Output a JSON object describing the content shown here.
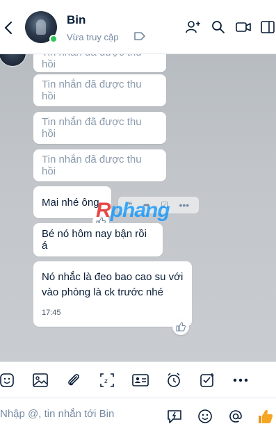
{
  "header": {
    "contact_name": "Bin",
    "status": "Vừa truy cập"
  },
  "messages": [
    {
      "text": "Tin nhắn đã được thu hồi",
      "recalled": true
    },
    {
      "text": "Tin nhắn đã được thu hồi",
      "recalled": true
    },
    {
      "text": "Tin nhắn đã được thu hồi",
      "recalled": true
    },
    {
      "text": "Tin nhắn đã được thu hồi",
      "recalled": true
    },
    {
      "text": "Mai nhé ông",
      "recalled": false
    },
    {
      "text": "Bé nó hôm nay bận rồi á",
      "recalled": false
    },
    {
      "text_line1": "Nó nhắc là đeo bao cao su với",
      "text_line2": "vào phòng là ck trước nhé",
      "time": "17:45",
      "recalled": false
    }
  ],
  "watermark": {
    "first": "R",
    "rest": "phang"
  },
  "composer": {
    "placeholder": "Nhập @, tin nhắn tới Bin"
  },
  "colors": {
    "online": "#30c659",
    "accent": "#0068ff",
    "chat_bg": "#c2c6ca",
    "like": "#f5a623"
  }
}
